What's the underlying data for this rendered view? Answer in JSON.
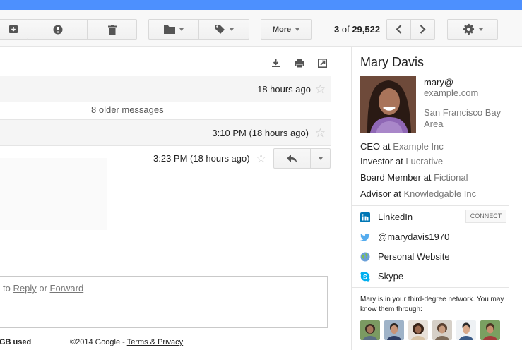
{
  "toolbar": {
    "archive_icon": "archive-icon",
    "report_icon": "report-spam-icon",
    "delete_icon": "trash-icon",
    "move_icon": "folder-icon",
    "labels_icon": "label-icon",
    "more_label": "More",
    "pager": {
      "current": "3",
      "of": "of",
      "total": "29,522"
    },
    "settings_icon": "gear-icon"
  },
  "thread": {
    "actions": [
      "download-icon",
      "print-icon",
      "new-window-icon"
    ],
    "messages": [
      {
        "time": "18 hours ago"
      },
      {
        "time": "3:10 PM (18 hours ago)"
      },
      {
        "time": "3:23 PM (18 hours ago)"
      }
    ],
    "older_messages": "8 older messages",
    "reply_prompt_prefix": "to",
    "reply_link": "Reply",
    "or_text": "or",
    "forward_link": "Forward"
  },
  "footer": {
    "storage": "GB used",
    "copyright": "©2014 Google -",
    "terms_link": "Terms & Privacy"
  },
  "profile": {
    "name": "Mary Davis",
    "email_line1": "mary@",
    "email_line2": "example.com",
    "location": "San Francisco Bay Area",
    "roles": [
      {
        "title": "CEO at",
        "org": "Example Inc"
      },
      {
        "title": "Investor at",
        "org": "Lucrative"
      },
      {
        "title": "Board Member at",
        "org": "Fictional"
      },
      {
        "title": "Advisor at",
        "org": "Knowledgable Inc"
      }
    ],
    "links": [
      {
        "label": "LinkedIn",
        "icon": "linkedin-icon"
      },
      {
        "label": "@marydavis1970",
        "icon": "twitter-icon"
      },
      {
        "label": "Personal Website",
        "icon": "globe-icon"
      },
      {
        "label": "Skype",
        "icon": "skype-icon"
      }
    ],
    "connect_label": "CONNECT",
    "network_text": "Mary is in your third-degree network. You may know them through:",
    "colors": {
      "linkedin": "#0077b5",
      "twitter": "#55acee",
      "skype": "#00aff0",
      "link_gray": "#777777"
    }
  }
}
